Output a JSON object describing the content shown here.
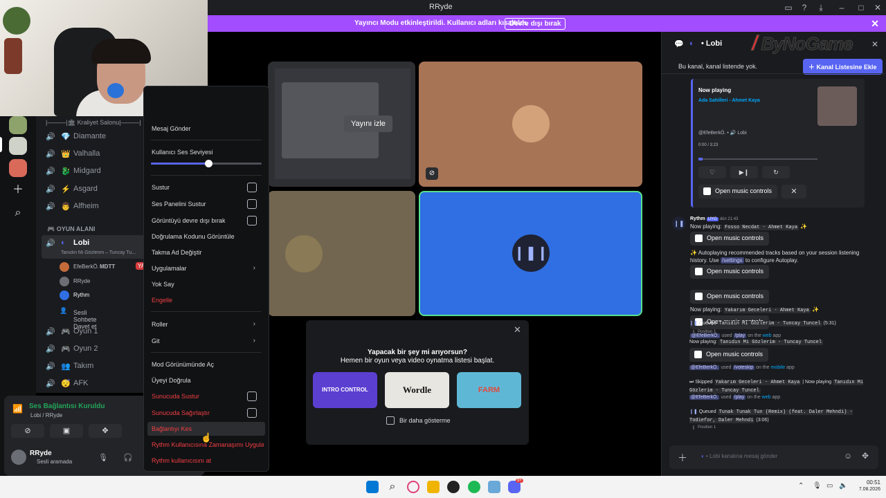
{
  "window": {
    "title": "RRyde"
  },
  "banner": {
    "message": "Yayıncı Modu etkinleştirildi. Kullanıcı adları kısaltıldı.",
    "button": "Devre dışı bırak"
  },
  "channels": {
    "header": "|———|🏛 Kraliyet Salonu|———|",
    "voice_top": [
      {
        "emoji": "💎",
        "label": "Diamante"
      },
      {
        "emoji": "👑",
        "label": "Valhalla"
      },
      {
        "emoji": "🐉",
        "label": "Midgard"
      },
      {
        "emoji": "⚡",
        "label": "Asgard"
      },
      {
        "emoji": "👨",
        "label": "Alfheim"
      }
    ],
    "category": "OYUN ALANI",
    "lobby": {
      "label": "Lobi",
      "status": "Tanıdın Mi Gözlerim – Tuncay Tu..."
    },
    "members": [
      {
        "name": "EfeBerkÖ.",
        "tag": "MDTT",
        "badge": "YA"
      },
      {
        "name": "RRyde"
      },
      {
        "name": "Rythm"
      }
    ],
    "invite": "Sesli Sohbete Davet et",
    "voice_bottom": [
      {
        "emoji": "🎮",
        "label": "Oyun 1"
      },
      {
        "emoji": "🎮",
        "label": "Oyun 2"
      },
      {
        "emoji": "👥",
        "label": "Takım"
      },
      {
        "emoji": "😴",
        "label": "AFK"
      }
    ]
  },
  "voice_panel": {
    "status": "Ses Bağlantısı Kuruldu",
    "location": "Lobi / RRyde"
  },
  "user": {
    "name": "RRyde",
    "status": "Sesli aramada"
  },
  "context_menu": {
    "send_message": "Mesaj Gönder",
    "user_volume": "Kullanıcı Ses Seviyesi",
    "volume_level": 0.52,
    "mute": "Sustur",
    "mute_soundboard": "Ses Panelini Sustur",
    "disable_video": "Görüntüyü devre dışı bırak",
    "view_verification": "Doğrulama Kodunu Görüntüle",
    "change_nickname": "Takma Ad Değiştir",
    "apps": "Uygulamalar",
    "ignore": "Yok Say",
    "block": "Engelle",
    "roles": "Roller",
    "go": "Git",
    "mod_view": "Mod Görünümünde Aç",
    "verify_member": "Üyeyi Doğrula",
    "server_mute": "Sunucuda Sustur",
    "server_deafen": "Sunucuda Sağırlaştır",
    "disconnect": "Bağlantıyı Kes",
    "timeout": "Rythm Kullanıcısına Zamanaşımı Uygula",
    "kick": "Rythm kullanıcısını at"
  },
  "stage": {
    "watch_stream": "Yayını izle",
    "activity_title": "Yapacak bir şey mi arıyorsun?",
    "activity_subtitle": "Hemen bir oyun veya video oynatma listesi başlat.",
    "games": [
      "INTRO CONTROL",
      "Wordle",
      "FARM"
    ],
    "dont_show": "Bir daha gösterme"
  },
  "chat": {
    "channel": "Lobi",
    "watermark": "ByNoGame",
    "not_in_list": "Bu kanal, kanal listende yok.",
    "add_button": "Kanal Listesine Ekle",
    "now_playing_label": "Now playing",
    "now_playing_track": "Ada Sahilleri - Ahmet Kaya",
    "embed_users": "@EfeBerkÖ. • 🔊 Lobi",
    "embed_time": "0:00 / 3:23",
    "open_controls": "Open music controls",
    "rythm_name": "Rythm",
    "rythm_badge": "UYG",
    "rythm_time": "dün 21:43",
    "messages": [
      {
        "type": "np",
        "text": "Now playing:",
        "code": "Fosso Necdat - Ahmet Kaya"
      },
      {
        "type": "text",
        "text": "✨ Autoplaying recommended tracks based on your session listening history. Use",
        "link": "/settings",
        "tail": "to configure Autoplay."
      },
      {
        "type": "np",
        "text": "Now playing:",
        "code": "Yakarım Geceleri - Ahmet Kaya"
      },
      {
        "type": "used",
        "mention": "@EfeBerkÖ.",
        "verb": "used",
        "cmd": "/play",
        "tail": "on the",
        "where": "web",
        "app": "app"
      },
      {
        "type": "queued",
        "text": "Queued",
        "code": "Tanıdın Mi Gözlerim - Tuncay Tuncel",
        "dur": "(5:31)",
        "pos": "Position 1"
      },
      {
        "type": "np",
        "text": "Now playing:",
        "code": "Tanıdın Mi Gözlerim - Tuncay Tuncel"
      },
      {
        "type": "used",
        "mention": "@EfeBerkÖ.",
        "verb": "used",
        "cmd": "/voteskip",
        "tail": "on the",
        "where": "mobile",
        "app": "app"
      },
      {
        "type": "skip",
        "text": "Skipped",
        "code": "Yakarım Geceleri - Ahmet Kaya",
        "mid": "| Now playing",
        "code2": "Tanıdın Mi Gözlerim - Tuncay Tuncel"
      },
      {
        "type": "used",
        "mention": "@EfeBerkÖ.",
        "verb": "used",
        "cmd": "/play",
        "tail": "on the",
        "where": "web",
        "app": "app"
      },
      {
        "type": "queued",
        "text": "Queued",
        "code": "Tunak Tunak Tun (Remix) (feat. Daler Mehndi) - Todiefor, Daler Mehndi",
        "dur": "(3:06)",
        "pos": "Position 1"
      }
    ],
    "input_placeholder": "Lobi kanalına mesaj gönder"
  },
  "taskbar": {
    "time": "00:51",
    "date": "7.08.2026",
    "badge": "9+"
  },
  "colors": {
    "accent": "#5865f2",
    "banner": "#a24dff",
    "danger": "#f23f43",
    "tile_brown": "#a87456",
    "tile_blue": "#2f6fe3",
    "tile_tan": "#726650"
  }
}
